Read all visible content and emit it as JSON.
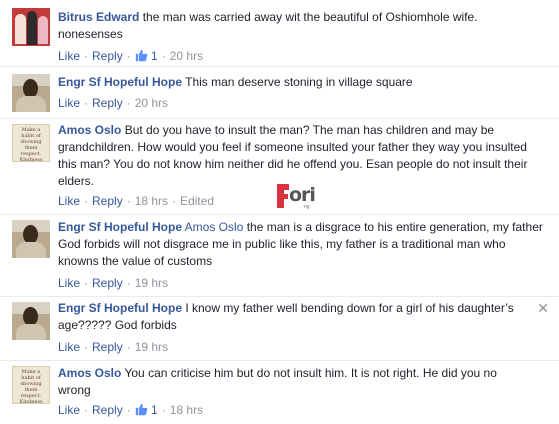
{
  "meta_labels": {
    "like": "Like",
    "reply": "Reply",
    "sep": "·"
  },
  "watermark": {
    "logo_text": "ori",
    "logo_sub": "ng"
  },
  "comments": [
    {
      "author": "Bitrus Edward",
      "text": "the man was carried away wit the beautiful of Oshiomhole wife. nonesenses",
      "likes": "1",
      "time": "20 hrs"
    },
    {
      "author": "Engr Sf Hopeful Hope",
      "text": "This man deserve stoning in village square",
      "time": "20 hrs"
    },
    {
      "author": "Amos Oslo",
      "avatar_text": "Make a habit of showing them respect. Kindness that aims to put others down",
      "text": "But do you have to insult the man? The man has children and may be grandchildren. How would you feel if someone insulted your father they way you insulted this man? You do not know him neither did he offend you. Esan people do not insult their elders.",
      "time": "18 hrs",
      "edited": "Edited"
    },
    {
      "author": "Engr Sf Hopeful Hope",
      "mention": "Amos Oslo",
      "text": "the man is a disgrace to his entire generation, my father God forbids will not disgrace me in public like this, my father is a traditional man who knowns the value of customs",
      "time": "19 hrs"
    },
    {
      "author": "Engr Sf Hopeful Hope",
      "text": "I know my father well bending down for a girl of his daughter’s age????? God forbids",
      "time": "19 hrs",
      "close": "✕"
    },
    {
      "author": "Amos Oslo",
      "avatar_text": "Make a habit of showing them respect. Kindness that aims to put others down",
      "text": "You can criticise him but do not insult him. It is not right. He did you no wrong",
      "likes": "1",
      "time": "18 hrs"
    }
  ]
}
